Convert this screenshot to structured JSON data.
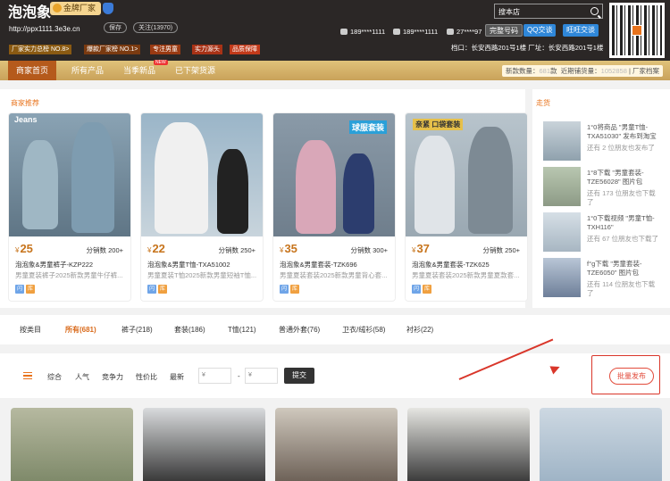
{
  "header": {
    "shop_name": "泡泡象",
    "gold_badge": "金牌厂家",
    "url": "http://ppx1111.3e3e.cn",
    "save_label": "保存",
    "follow_label": "关注(13970)",
    "tags": [
      {
        "label": "厂家实力总榜 NO.8>",
        "color": "#8a5a12"
      },
      {
        "label": "爆款厂家榜 NO.1>",
        "color": "#7a3a10"
      },
      {
        "label": "专注男童",
        "color": "#9a3a12"
      },
      {
        "label": "实力源头",
        "color": "#a83216"
      },
      {
        "label": "品质保障",
        "color": "#c23a1a"
      }
    ],
    "contacts": {
      "wechat": "189****1111",
      "phone": "189****1111",
      "qq": "27****97"
    },
    "search_placeholder": "搜本店",
    "buttons": {
      "complete_number": "完整号码",
      "qq_chat": "QQ交谈",
      "wangwang_chat": "旺旺交谈"
    },
    "address": "档口：长安西路201号1楼   厂址：长安西路201号1楼"
  },
  "nav": {
    "items": [
      "商家首页",
      "所有产品",
      "当季新品",
      "已下架货源"
    ],
    "new_badge": "NEW",
    "stats": {
      "new_label": "新款数量：",
      "new_value": "681",
      "count_label": "款",
      "recent_label": "近期铺货量：",
      "recent_value": "1052858",
      "factory_label": "厂家档案"
    }
  },
  "recommend": {
    "title": "商家推荐",
    "products": [
      {
        "price": "25",
        "dist": "分销数 200+",
        "title": "泡泡象&男童裤子-KZP222",
        "desc": "男童夏装裤子2025新款男童牛仔裤..."
      },
      {
        "price": "22",
        "dist": "分销数 250+",
        "title": "泡泡象&男童T恤-TXA51002",
        "desc": "男童夏装T恤2025新款男童短袖T恤..."
      },
      {
        "price": "35",
        "dist": "分销数 300+",
        "title": "泡泡象&男童套装-TZK696",
        "desc": "男童夏装套装2025新款男童背心套..."
      },
      {
        "price": "37",
        "dist": "分销数 250+",
        "title": "泡泡象&男童套装-TZK625",
        "desc": "男童夏装套装2025新款男童夏款套..."
      }
    ],
    "image_banners": [
      "Jeans",
      "",
      "球服套装",
      "亲紧 口袋套装"
    ],
    "chip_labels": [
      "闪",
      "库"
    ],
    "currency": "¥"
  },
  "hot": {
    "title": "走货",
    "items": [
      {
        "line1": "1°0将商品 \"男童T恤-TXA51030\" 发布到淘宝",
        "line2": "还有 2 位朋友也发布了"
      },
      {
        "line1": "1°8下载 \"男童套装-TZE56028\" 图片包",
        "line2": "还有 173 位朋友也下载了"
      },
      {
        "line1": "1°0下载视频 \"男童T恤-TXH116\"",
        "line2": "还有 67 位朋友也下载了"
      },
      {
        "line1": "f°g下载 \"男童套装-TZE6050\" 图片包",
        "line2": "还有 114 位朋友也下载了"
      }
    ]
  },
  "tabs": [
    "按类目",
    "所有(681)",
    "裤子(218)",
    "套装(186)",
    "T恤(121)",
    "普通外套(76)",
    "卫衣/绒衫(58)",
    "衬衫(22)"
  ],
  "filter": {
    "sort_options": [
      "综合",
      "人气",
      "竞争力",
      "性价比",
      "最新"
    ],
    "price_min_placeholder": "¥",
    "price_max_placeholder": "¥",
    "dash": "-",
    "submit_label": "提交",
    "batch_label": "批量发布"
  }
}
